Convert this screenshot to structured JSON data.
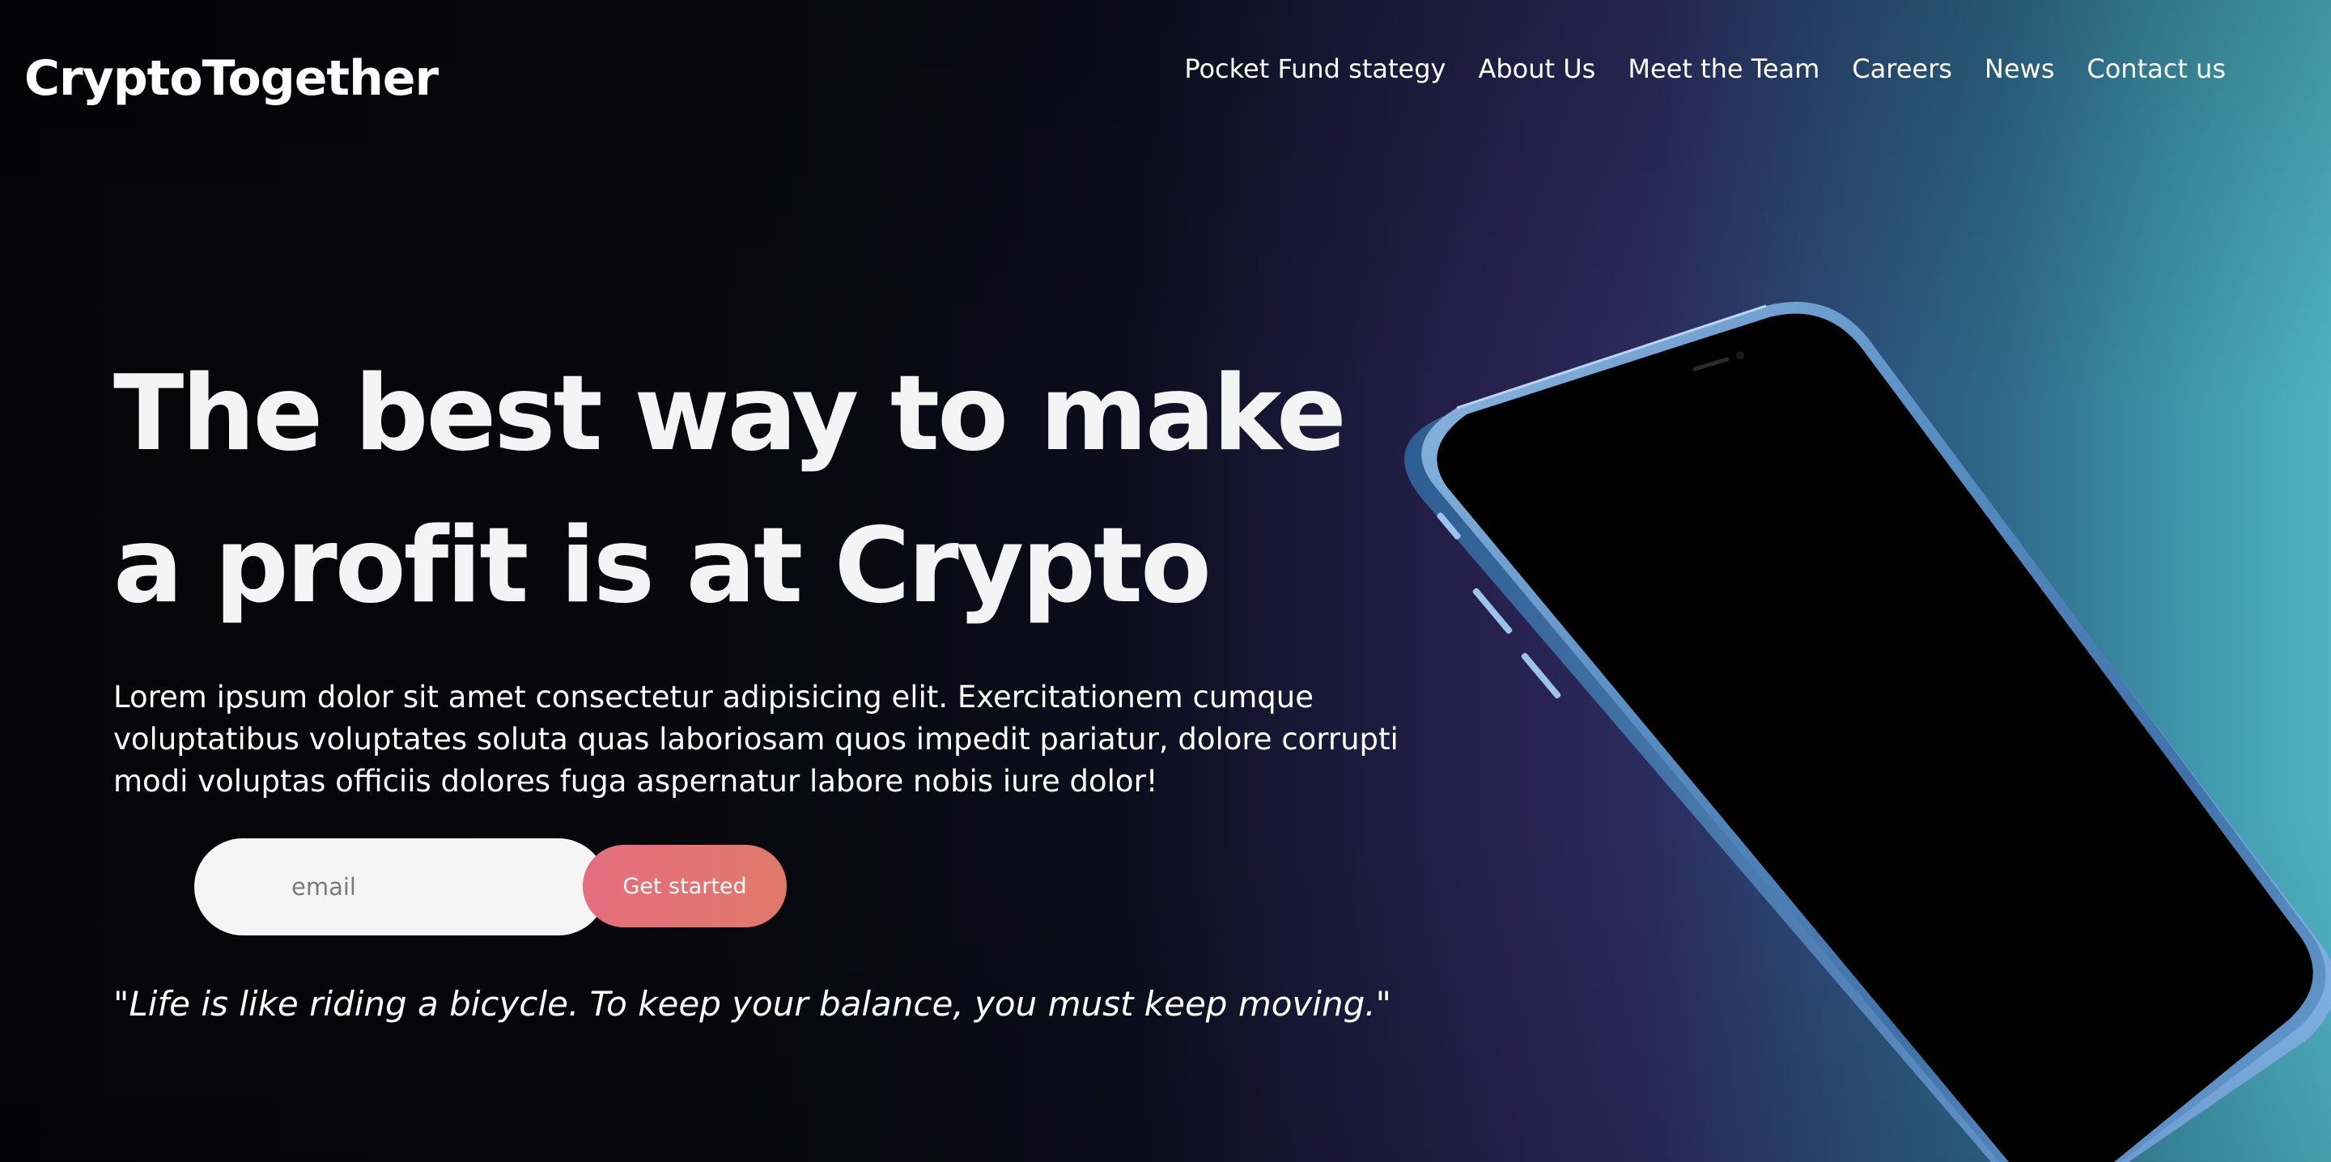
{
  "header": {
    "logo": "CryptoTogether",
    "nav": [
      {
        "label": "Pocket Fund stategy"
      },
      {
        "label": "About Us"
      },
      {
        "label": "Meet the Team"
      },
      {
        "label": "Careers"
      },
      {
        "label": "News"
      },
      {
        "label": "Contact us"
      }
    ]
  },
  "hero": {
    "headline": "The best way to make a profit is at Crypto",
    "description": "Lorem ipsum dolor sit amet consectetur adipisicing elit. Exercitationem cumque voluptatibus voluptates soluta quas laboriosam quos impedit pariatur, dolore corrupti modi voluptas officiis dolores fuga aspernatur labore nobis iure dolor!",
    "email_placeholder": "email",
    "email_value": "",
    "cta_label": "Get started",
    "quote": "\"Life is like riding a bicycle. To keep your balance, you must keep moving.\""
  },
  "colors": {
    "background_dark": "#050508",
    "background_purple": "#28224f",
    "background_teal": "#4fb3c2",
    "cta_start": "#e46d7e",
    "cta_end": "#e07a6b",
    "input_bg": "#f5f5f5",
    "phone_frame": "#5a8fc4"
  },
  "illustration": {
    "icon": "smartphone-icon"
  }
}
